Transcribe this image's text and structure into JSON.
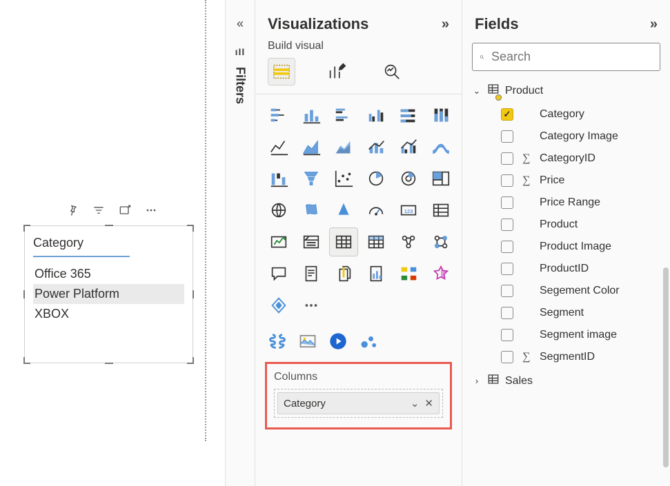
{
  "panels": {
    "filters_label": "Filters",
    "viz_title": "Visualizations",
    "viz_subtitle": "Build visual",
    "fields_title": "Fields"
  },
  "search": {
    "placeholder": "Search"
  },
  "slicer": {
    "title": "Category",
    "items": [
      "Office 365",
      "Power Platform",
      "XBOX"
    ],
    "selected_index": 1
  },
  "columns": {
    "label": "Columns",
    "field": "Category"
  },
  "tables": {
    "product": {
      "name": "Product",
      "expanded": true,
      "fields": [
        {
          "label": "Category",
          "checked": true,
          "agg": false
        },
        {
          "label": "Category Image",
          "checked": false,
          "agg": false
        },
        {
          "label": "CategoryID",
          "checked": false,
          "agg": true
        },
        {
          "label": "Price",
          "checked": false,
          "agg": true
        },
        {
          "label": "Price Range",
          "checked": false,
          "agg": false
        },
        {
          "label": "Product",
          "checked": false,
          "agg": false
        },
        {
          "label": "Product Image",
          "checked": false,
          "agg": false
        },
        {
          "label": "ProductID",
          "checked": false,
          "agg": false
        },
        {
          "label": "Segement Color",
          "checked": false,
          "agg": false
        },
        {
          "label": "Segment",
          "checked": false,
          "agg": false
        },
        {
          "label": "Segment image",
          "checked": false,
          "agg": false
        },
        {
          "label": "SegmentID",
          "checked": false,
          "agg": true
        }
      ]
    },
    "sales": {
      "name": "Sales",
      "expanded": false
    }
  },
  "viz_icons": [
    "stacked-bar",
    "stacked-column",
    "clustered-bar",
    "clustered-column",
    "100-stacked-bar",
    "100-stacked-column",
    "line",
    "area",
    "stacked-area",
    "line-stacked-column",
    "line-clustered-column",
    "ribbon",
    "waterfall",
    "funnel",
    "scatter",
    "pie",
    "donut",
    "treemap",
    "map",
    "filled-map",
    "azure-map",
    "gauge",
    "card",
    "multi-row-card",
    "kpi",
    "slicer",
    "table",
    "matrix",
    "r-visual",
    "py-visual",
    "qna",
    "report",
    "paginated",
    "key-influencers",
    "decomposition-tree",
    "smart-narrative",
    "powerapps",
    "more"
  ],
  "ai_icons": [
    "ai-brain",
    "image",
    "play-o",
    "bubbles"
  ]
}
